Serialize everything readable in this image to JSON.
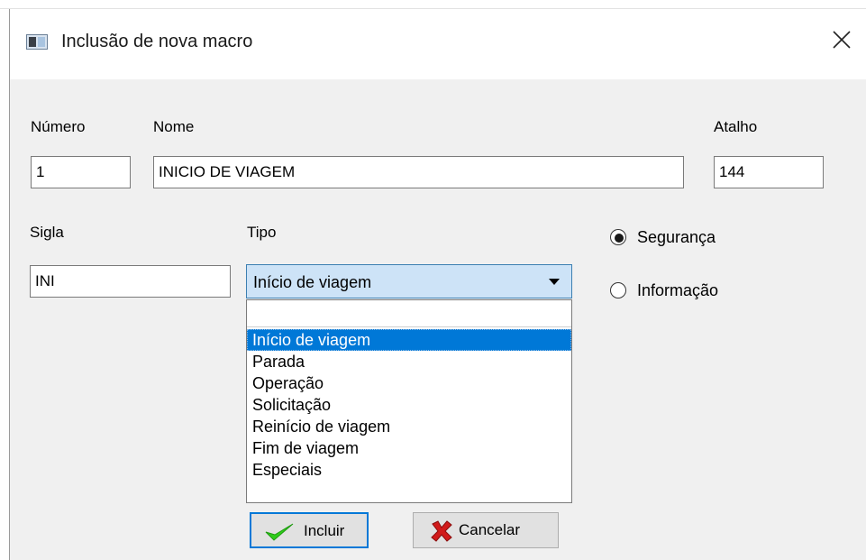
{
  "window": {
    "title": "Inclusão de nova macro"
  },
  "labels": {
    "numero": "Número",
    "nome": "Nome",
    "atalho": "Atalho",
    "sigla": "Sigla",
    "tipo": "Tipo"
  },
  "fields": {
    "numero_value": "1",
    "nome_value": "INICIO DE VIAGEM",
    "atalho_value": "144",
    "sigla_value": "INI"
  },
  "tipo_select": {
    "selected": "Início de viagem",
    "options": [
      "Início de viagem",
      "Parada",
      "Operação",
      "Solicitação",
      "Reinício de viagem",
      "Fim de viagem",
      "Especiais"
    ]
  },
  "radios": {
    "seguranca": "Segurança",
    "informacao": "Informação",
    "checked": "Segurança"
  },
  "buttons": {
    "incluir": "Incluir",
    "cancelar": "Cancelar"
  },
  "colors": {
    "accent": "#0078d7",
    "select_bg": "#cde3f7",
    "window_bg": "#f0f0f0",
    "check_icon": "#2ecc1a",
    "cancel_icon": "#d11a1a"
  }
}
